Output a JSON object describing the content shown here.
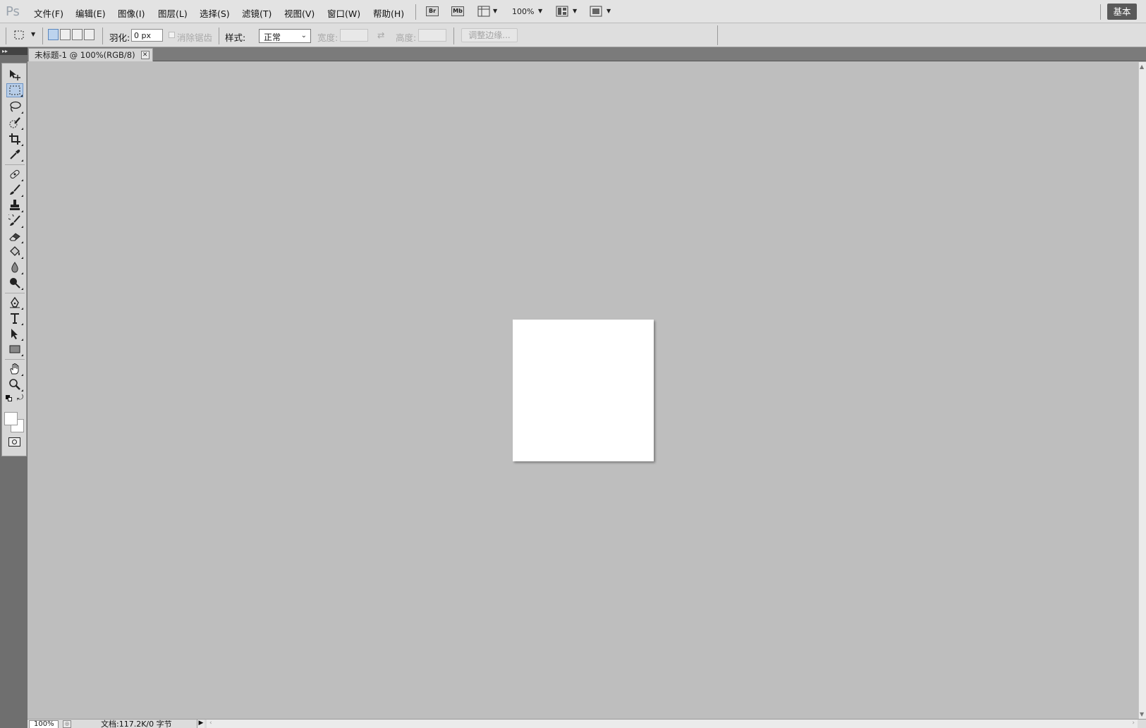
{
  "app": {
    "logo": "Ps"
  },
  "menu": [
    {
      "label": "文件(F)"
    },
    {
      "label": "编辑(E)"
    },
    {
      "label": "图像(I)"
    },
    {
      "label": "图层(L)"
    },
    {
      "label": "选择(S)"
    },
    {
      "label": "滤镜(T)"
    },
    {
      "label": "视图(V)"
    },
    {
      "label": "窗口(W)"
    },
    {
      "label": "帮助(H)"
    }
  ],
  "appbar": {
    "bridge_label": "Br",
    "minibridge_label": "Mb",
    "zoom": "100%",
    "workspace_label": "基本"
  },
  "options": {
    "feather_label": "羽化:",
    "feather_value": "0 px",
    "antialias_label": "消除锯齿",
    "style_label": "样式:",
    "style_value": "正常",
    "width_label": "宽度:",
    "height_label": "高度:",
    "refine_edge_label": "调整边缘..."
  },
  "document": {
    "tab_title": "未标题-1 @ 100%(RGB/8)",
    "canvas_color": "#ffffff"
  },
  "status": {
    "zoom": "100%",
    "doc_info": "文档:117.2K/0 字节"
  },
  "tools": [
    "move-tool",
    "rectangular-marquee-tool",
    "lasso-tool",
    "quick-selection-tool",
    "crop-tool",
    "eyedropper-tool",
    "spot-healing-brush-tool",
    "brush-tool",
    "clone-stamp-tool",
    "history-brush-tool",
    "eraser-tool",
    "paint-bucket-tool",
    "blur-tool",
    "dodge-tool",
    "pen-tool",
    "type-tool",
    "path-selection-tool",
    "rectangle-tool",
    "hand-tool",
    "zoom-tool"
  ],
  "colors": {
    "foreground": "#ffffff",
    "background": "#ffffff",
    "accent": "#6d94c6"
  }
}
